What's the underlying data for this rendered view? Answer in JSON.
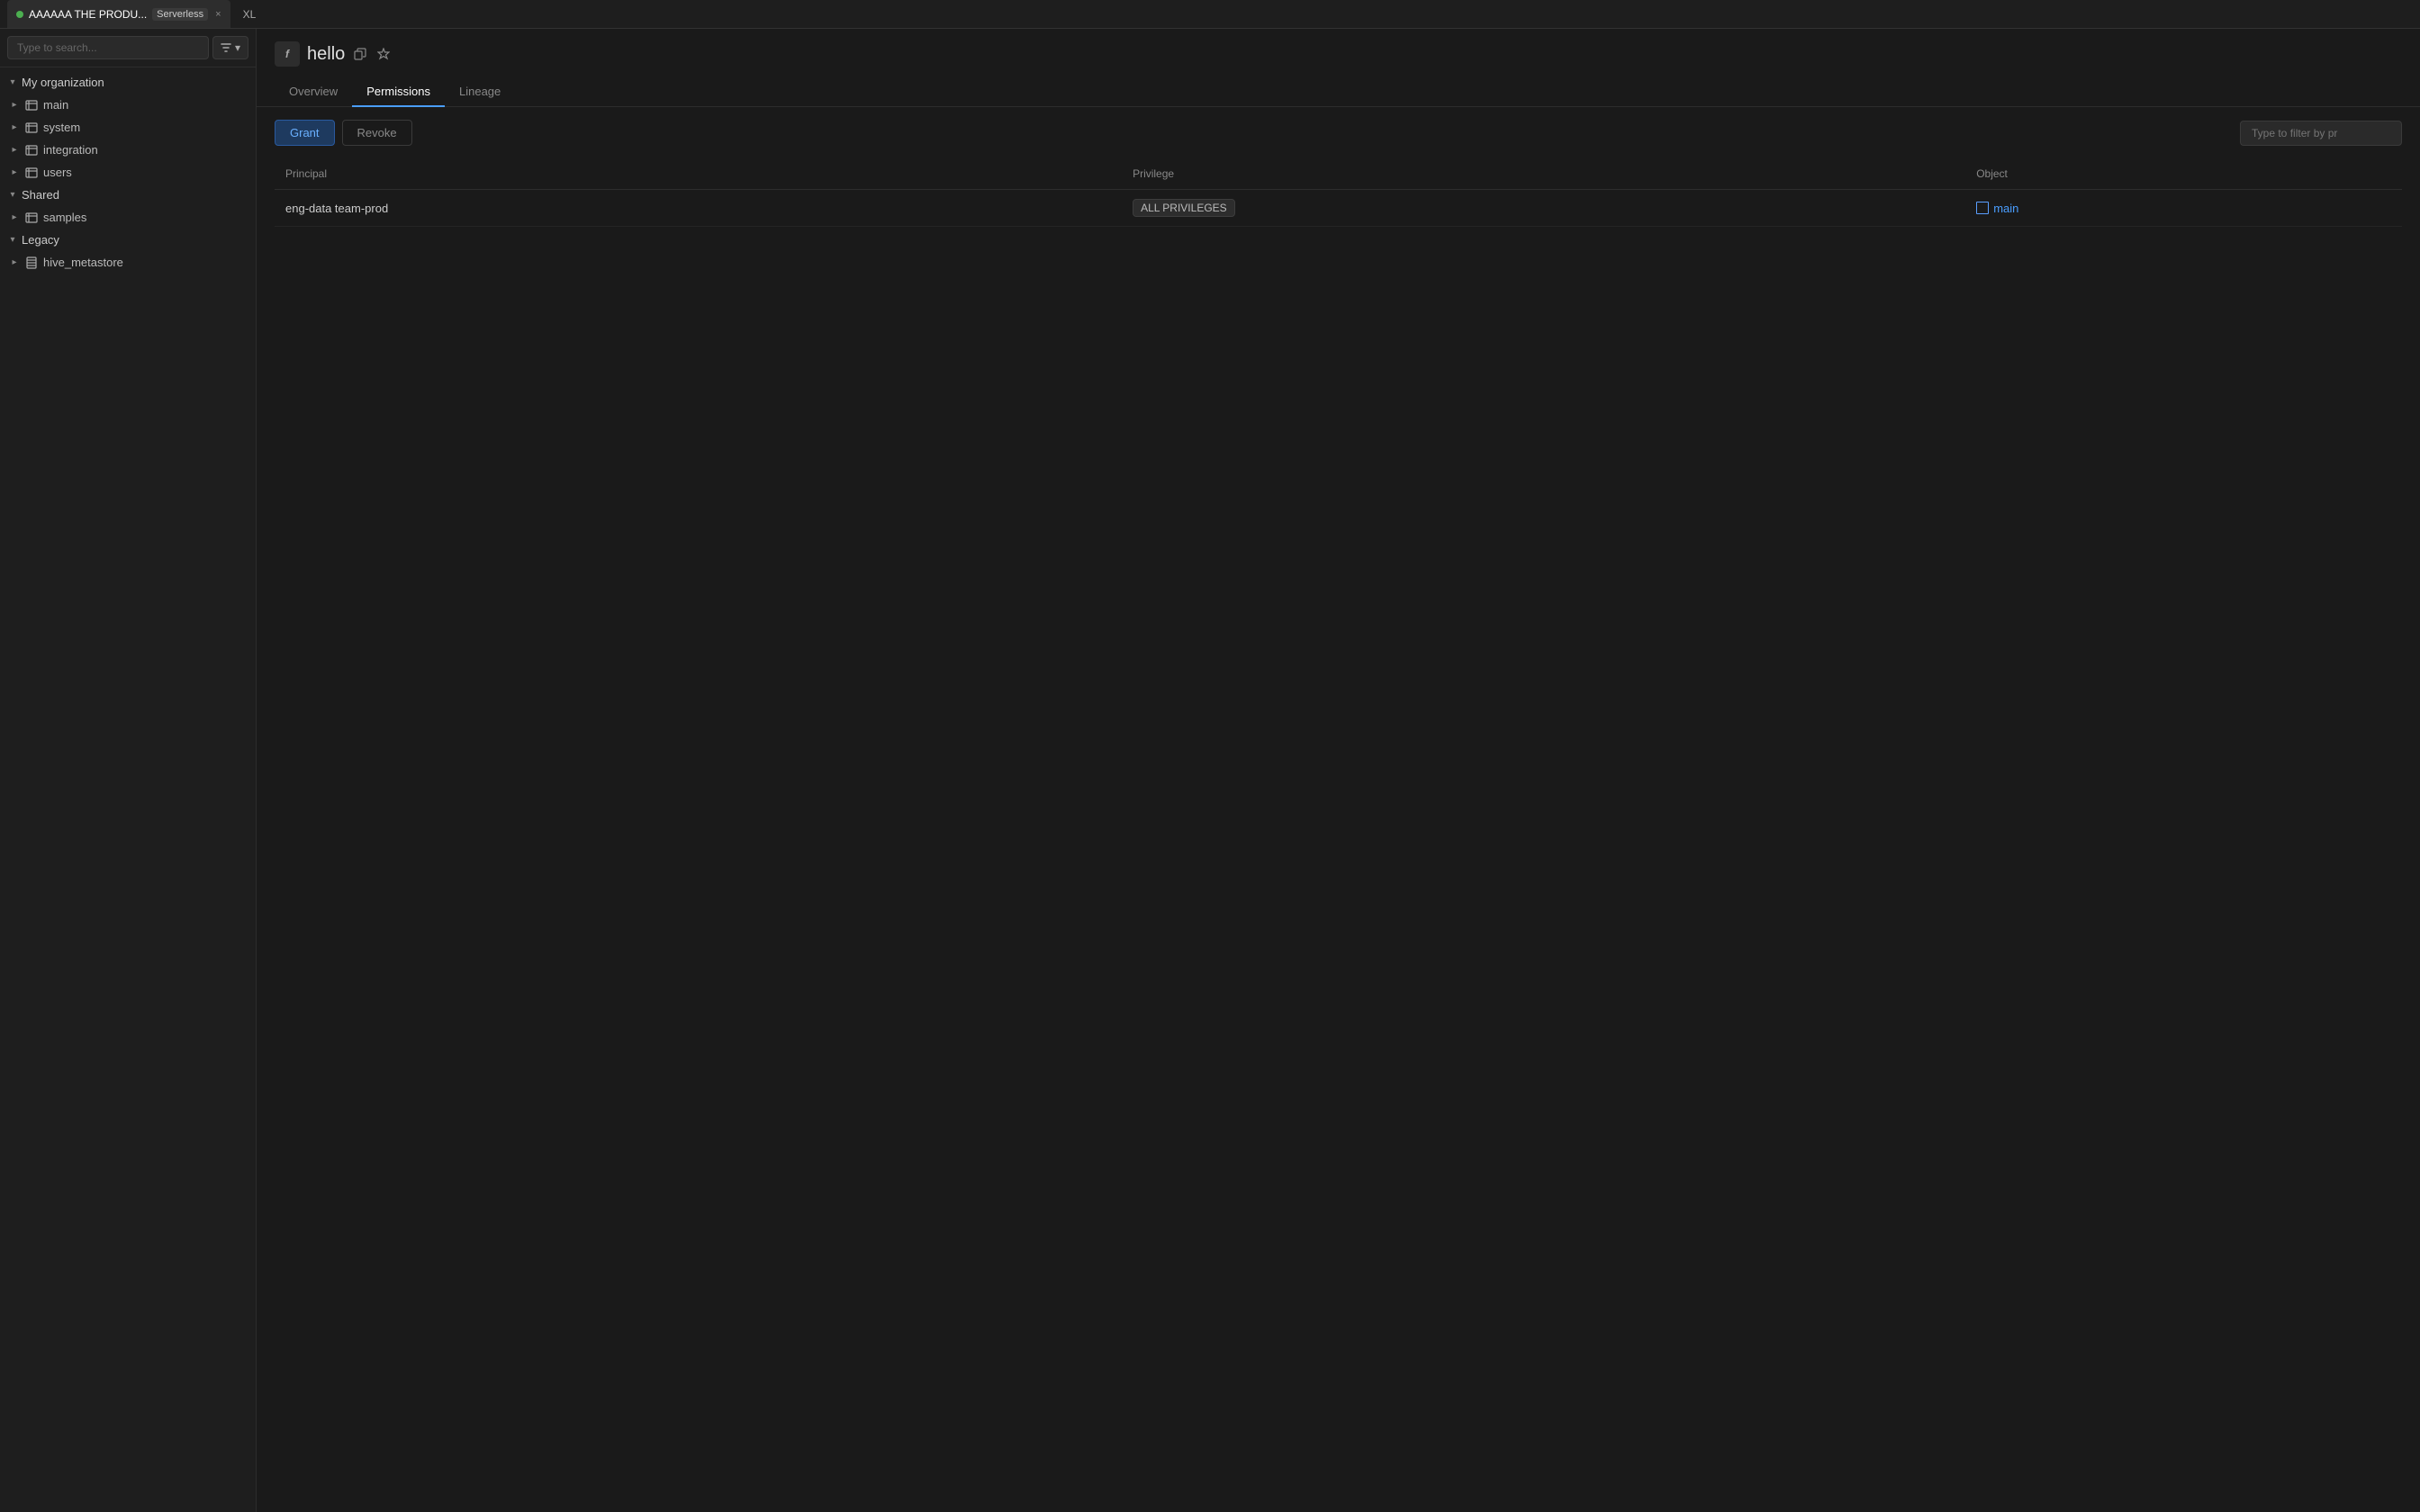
{
  "tabBar": {
    "tabs": [
      {
        "id": "main-tab",
        "dot": true,
        "label": "AAAAAA THE PRODU...",
        "badge": "Serverless",
        "close": "×",
        "active": true
      },
      {
        "id": "xl-tab",
        "label": "XL",
        "active": false
      }
    ]
  },
  "sidebar": {
    "searchPlaceholder": "Type to search...",
    "filterLabel": "Filter",
    "myOrg": {
      "label": "My organization",
      "expanded": true,
      "items": [
        {
          "id": "main",
          "label": "main",
          "type": "catalog"
        },
        {
          "id": "system",
          "label": "system",
          "type": "catalog"
        },
        {
          "id": "integration",
          "label": "integration",
          "type": "catalog"
        },
        {
          "id": "users",
          "label": "users",
          "type": "catalog"
        }
      ]
    },
    "shared": {
      "label": "Shared",
      "expanded": true,
      "items": [
        {
          "id": "samples",
          "label": "samples",
          "type": "catalog"
        }
      ]
    },
    "legacy": {
      "label": "Legacy",
      "expanded": true,
      "items": [
        {
          "id": "hive_metastore",
          "label": "hive_metastore",
          "type": "hive"
        }
      ]
    }
  },
  "content": {
    "funcIconLabel": "f",
    "title": "hello",
    "tabs": [
      {
        "id": "overview",
        "label": "Overview",
        "active": false
      },
      {
        "id": "permissions",
        "label": "Permissions",
        "active": true
      },
      {
        "id": "lineage",
        "label": "Lineage",
        "active": false
      }
    ],
    "toolbar": {
      "grantLabel": "Grant",
      "revokeLabel": "Revoke",
      "filterPlaceholder": "Type to filter by pr"
    },
    "table": {
      "columns": [
        {
          "id": "principal",
          "label": "Principal"
        },
        {
          "id": "privilege",
          "label": "Privilege"
        },
        {
          "id": "object",
          "label": "Object"
        }
      ],
      "rows": [
        {
          "principal": "eng-data team-prod",
          "privilege": "ALL PRIVILEGES",
          "objectLabel": "main",
          "objectLink": "#"
        }
      ]
    }
  }
}
